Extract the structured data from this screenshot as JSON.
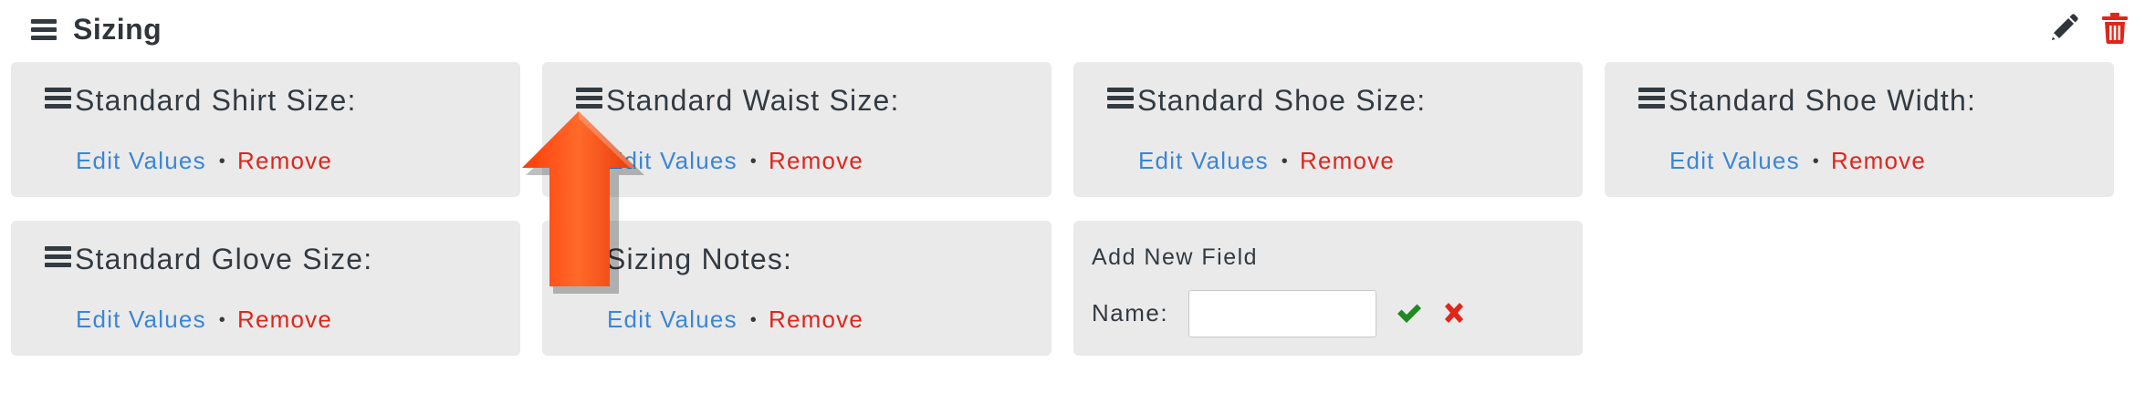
{
  "section": {
    "title": "Sizing",
    "icons": {
      "drag": "hamburger-icon",
      "edit": "pencil-icon",
      "delete": "trash-icon"
    }
  },
  "fields": [
    {
      "label": "Standard Shirt Size:",
      "edit_label": "Edit Values",
      "separator": "•",
      "remove_label": "Remove"
    },
    {
      "label": "Standard Waist Size:",
      "edit_label": "Edit Values",
      "separator": "•",
      "remove_label": "Remove"
    },
    {
      "label": "Standard Shoe Size:",
      "edit_label": "Edit Values",
      "separator": "•",
      "remove_label": "Remove"
    },
    {
      "label": "Standard Shoe Width:",
      "edit_label": "Edit Values",
      "separator": "•",
      "remove_label": "Remove"
    },
    {
      "label": "Standard Glove Size:",
      "edit_label": "Edit Values",
      "separator": "•",
      "remove_label": "Remove"
    },
    {
      "label": "Sizing Notes:",
      "edit_label": "Edit Values",
      "separator": "•",
      "remove_label": "Remove"
    }
  ],
  "add_field": {
    "title": "Add New Field",
    "name_label": "Name:",
    "name_value": "",
    "confirm_icon": "checkmark-icon",
    "cancel_icon": "x-icon"
  },
  "colors": {
    "card_bg": "#eaeaea",
    "link_blue": "#3a86d6",
    "remove_red": "#e0251b",
    "confirm_green": "#1f8a1f",
    "cancel_red": "#e0251b",
    "delete_red": "#e0251b",
    "annotation_arrow": "#ff4a12"
  },
  "annotation": {
    "icon": "up-arrow-icon"
  }
}
